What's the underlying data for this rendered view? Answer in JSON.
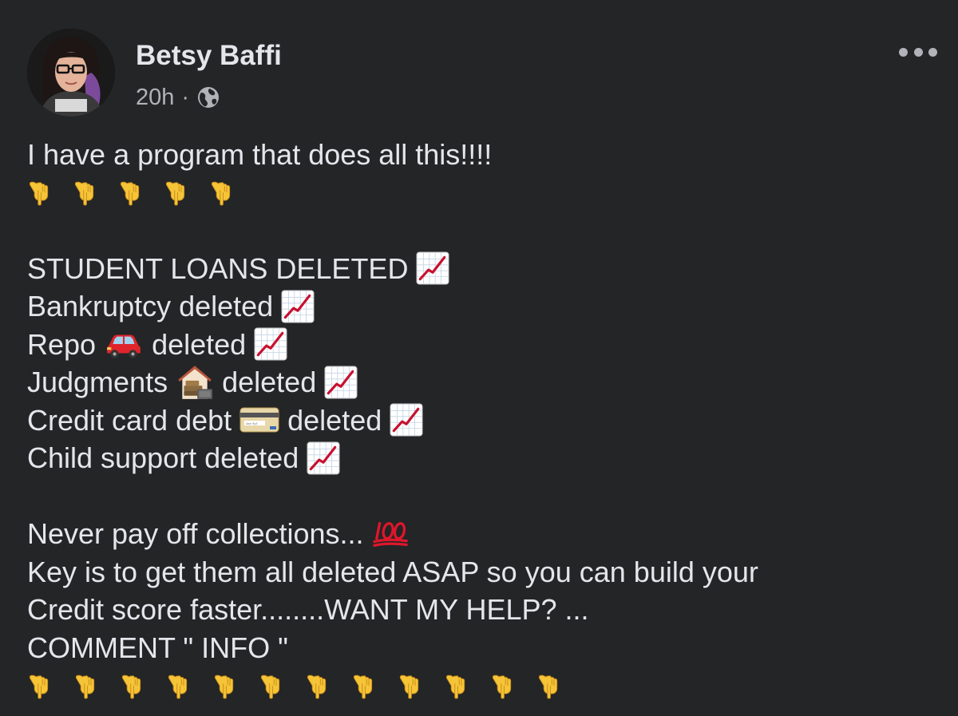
{
  "post": {
    "author": "Betsy Baffi",
    "timestamp": "20h",
    "separator": "·",
    "privacy_icon": "globe-icon",
    "menu_icon": "more-options-icon",
    "colors": {
      "background": "#242526",
      "primary_text": "#e4e6eb",
      "secondary_text": "#b0b3b8",
      "chart_red": "#c8102e",
      "emoji_yellow": "#f6c437"
    },
    "lines": [
      "I have a program that does all this!!!!",
      "STUDENT LOANS DELETED",
      "Bankruptcy deleted",
      "Repo",
      "deleted",
      "Judgments",
      "deleted",
      "Credit card debt",
      "deleted",
      "Child support deleted",
      "Never pay off collections...",
      "Key is to get them all deleted ASAP so you can build your",
      "Credit score faster........WANT MY HELP? ...",
      "COMMENT \" INFO \""
    ],
    "emoji": {
      "pointing_down": "backhand-index-pointing-down-icon",
      "chart_increasing": "chart-increasing-icon",
      "car": "red-car-icon",
      "judgment": "house-and-money-icon",
      "credit_card": "credit-card-icon",
      "hundred": "hundred-points-icon"
    }
  }
}
